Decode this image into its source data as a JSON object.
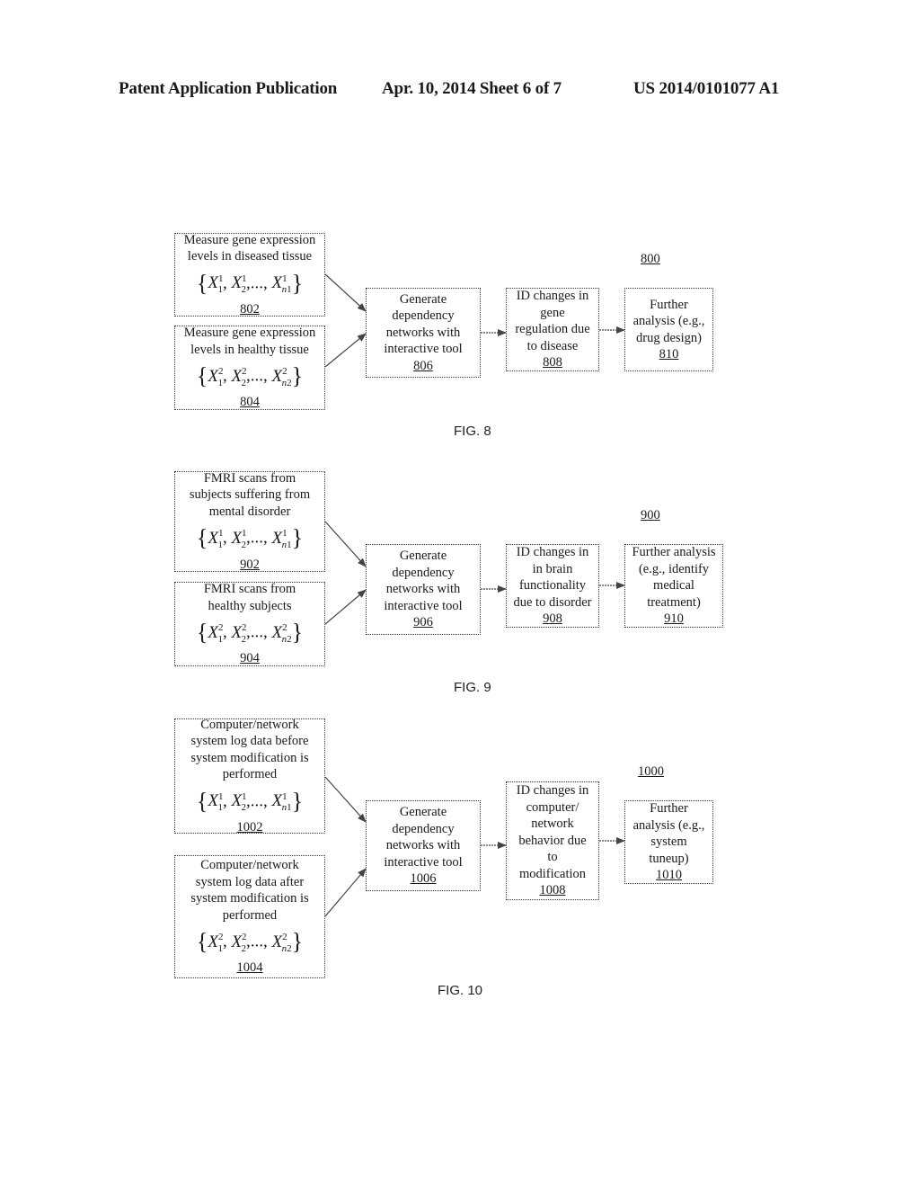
{
  "header": {
    "left": "Patent Application Publication",
    "middle": "Apr. 10, 2014  Sheet 6 of 7",
    "right": "US 2014/0101077 A1"
  },
  "figures": [
    {
      "id": "fig8",
      "caption": "FIG. 8",
      "figure_ref": "800",
      "input_top": {
        "text": "Measure gene expression\nlevels in diseased tissue",
        "set_superscript": "1",
        "last_sub": "n1",
        "ref": "802"
      },
      "input_bottom": {
        "text": "Measure gene expression\nlevels in healthy tissue",
        "set_superscript": "2",
        "last_sub": "n2",
        "ref": "804"
      },
      "generate": {
        "text": "Generate\ndependency\nnetworks with\ninteractive tool",
        "ref": "806"
      },
      "identify": {
        "text": "ID changes in\ngene\nregulation due\nto disease",
        "ref": "808"
      },
      "further": {
        "text": "Further\nanalysis (e.g.,\ndrug design)",
        "ref": "810"
      }
    },
    {
      "id": "fig9",
      "caption": "FIG. 9",
      "figure_ref": "900",
      "input_top": {
        "text": "FMRI scans from\nsubjects suffering from\nmental disorder",
        "set_superscript": "1",
        "last_sub": "n1",
        "ref": "902"
      },
      "input_bottom": {
        "text": "FMRI scans from\nhealthy subjects",
        "set_superscript": "2",
        "last_sub": "n2",
        "ref": "904"
      },
      "generate": {
        "text": "Generate\ndependency\nnetworks with\ninteractive tool",
        "ref": "906"
      },
      "identify": {
        "text": "ID changes in\nin brain\nfunctionality\ndue to disorder",
        "ref": "908"
      },
      "further": {
        "text": "Further analysis\n(e.g., identify\nmedical\ntreatment)",
        "ref": "910"
      }
    },
    {
      "id": "fig10",
      "caption": "FIG. 10",
      "figure_ref": "1000",
      "input_top": {
        "text": "Computer/network\nsystem log data before\nsystem modification is\nperformed",
        "set_superscript": "1",
        "last_sub": "n1",
        "ref": "1002"
      },
      "input_bottom": {
        "text": "Computer/network\nsystem log data after\nsystem modification is\nperformed",
        "set_superscript": "2",
        "last_sub": "n2",
        "ref": "1004"
      },
      "generate": {
        "text": "Generate\ndependency\nnetworks with\ninteractive tool",
        "ref": "1006"
      },
      "identify": {
        "text": "ID changes in\ncomputer/\nnetwork\nbehavior due\nto\nmodification",
        "ref": "1008"
      },
      "further": {
        "text": "Further\nanalysis (e.g.,\nsystem\ntuneup)",
        "ref": "1010"
      }
    }
  ],
  "math": {
    "variable": "X",
    "sub1": "1",
    "sub2": "2",
    "ellipsis": ",..., "
  }
}
